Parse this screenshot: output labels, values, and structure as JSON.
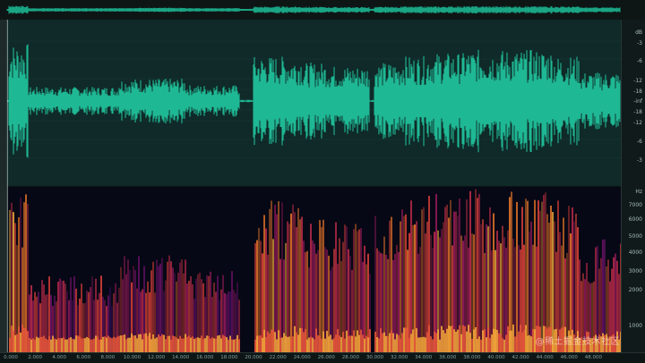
{
  "waveform": {
    "db_unit": "dB",
    "db_labels": [
      "dB",
      "-3",
      "-6",
      "-12",
      "-18",
      "-inf",
      "-18",
      "-12",
      "-6",
      "-3"
    ],
    "fill_color": "#1fb894",
    "background_color": "#0f2a28"
  },
  "spectrogram": {
    "hz_unit": "Hz",
    "hz_labels": [
      "Hz",
      "7000",
      "6000",
      "5000",
      "4000",
      "3000",
      "2000",
      "1000"
    ]
  },
  "timeline": {
    "labels": [
      "0.000",
      "2.000",
      "4.000",
      "6.000",
      "8.000",
      "10.000",
      "12.000",
      "14.000",
      "16.000",
      "18.000",
      "20.000",
      "22.000",
      "24.000",
      "26.000",
      "28.000",
      "30.000",
      "32.000",
      "34.000",
      "36.000",
      "38.000",
      "40.000",
      "42.000",
      "44.000",
      "46.000",
      "48.000"
    ]
  },
  "watermark": {
    "text": "@稀土掘金技术社区"
  }
}
